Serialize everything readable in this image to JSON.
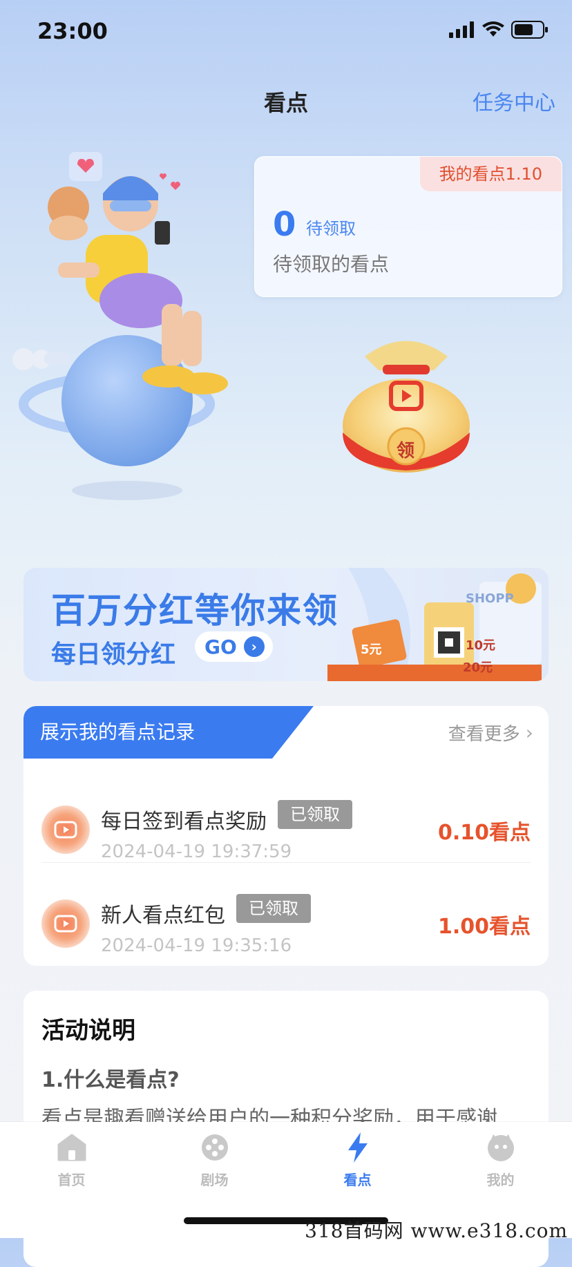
{
  "status_bar": {
    "time": "23:00"
  },
  "header": {
    "title": "看点",
    "task_center": "任务中心"
  },
  "points_card": {
    "badge": "我的看点1.10",
    "value": "0",
    "pending_label": "待领取",
    "description": "待领取的看点"
  },
  "red_envelope": {
    "label": "领"
  },
  "banner": {
    "title": "百万分红等你来领",
    "subtitle": "每日领分红",
    "go_label": "GO",
    "shop_text": "SHOPP",
    "coupon_labels": [
      "5元",
      "10元",
      "20元"
    ]
  },
  "records": {
    "header": "展示我的看点记录",
    "more_label": "查看更多",
    "items": [
      {
        "name": "每日签到看点奖励",
        "tag": "已领取",
        "date": "2024-04-19 19:37:59",
        "amount": "0.10看点"
      },
      {
        "name": "新人看点红包",
        "tag": "已领取",
        "date": "2024-04-19 19:35:16",
        "amount": "1.00看点"
      }
    ]
  },
  "activity": {
    "title": "活动说明",
    "question": "1.什么是看点?",
    "text": "看点是趣看赠送给用户的一种积分奖励，用于感谢"
  },
  "tabs": [
    {
      "label": "首页",
      "icon": "home-icon",
      "active": false
    },
    {
      "label": "剧场",
      "icon": "theater-icon",
      "active": false
    },
    {
      "label": "看点",
      "icon": "lightning-icon",
      "active": true
    },
    {
      "label": "我的",
      "icon": "profile-icon",
      "active": false
    }
  ],
  "watermark": "318首码网 www.e318.com",
  "colors": {
    "accent": "#3a7bf0",
    "amount": "#e6532c",
    "tag_bg": "#999999"
  }
}
